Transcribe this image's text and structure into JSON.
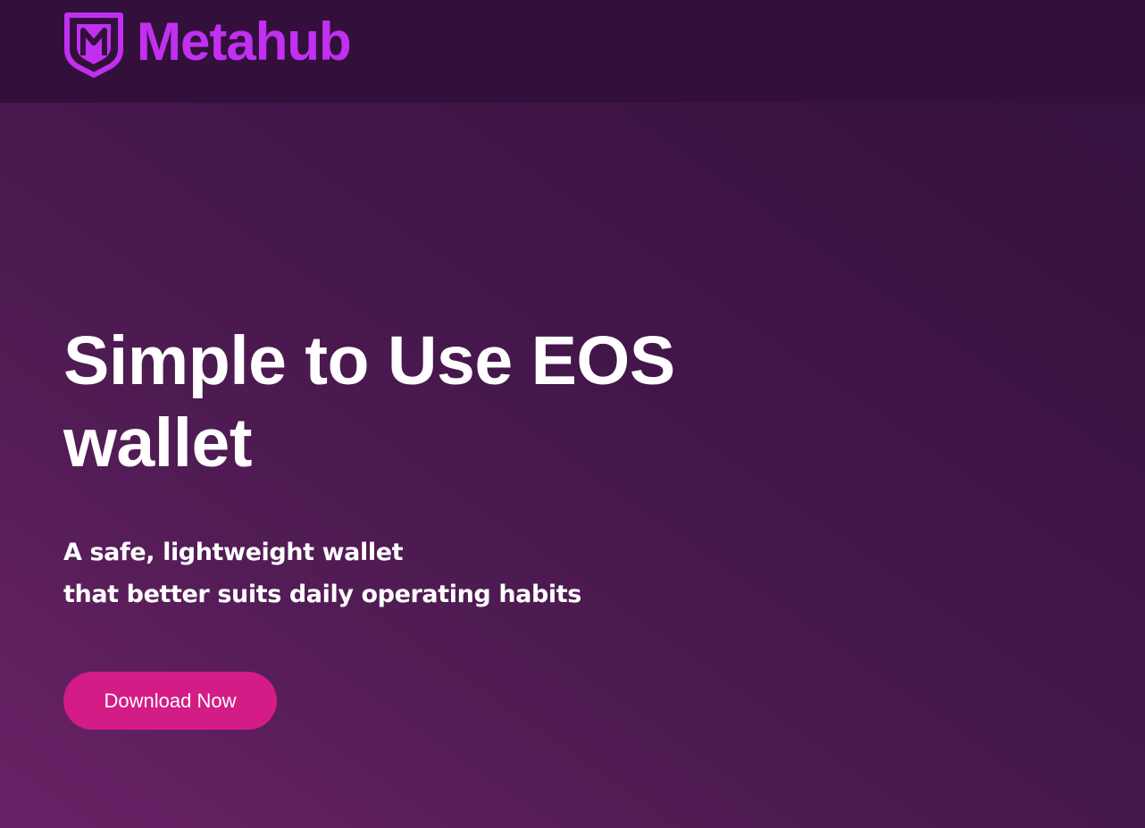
{
  "header": {
    "brand_name": "Metahub",
    "logo_icon": "shield-m-icon",
    "brand_color": "#c130f0"
  },
  "hero": {
    "title": "Simple to Use EOS wallet",
    "subtitle_line1": "A safe, lightweight wallet",
    "subtitle_line2": "that better suits daily operating habits",
    "cta_label": "Download Now",
    "cta_color": "#d41c86"
  }
}
